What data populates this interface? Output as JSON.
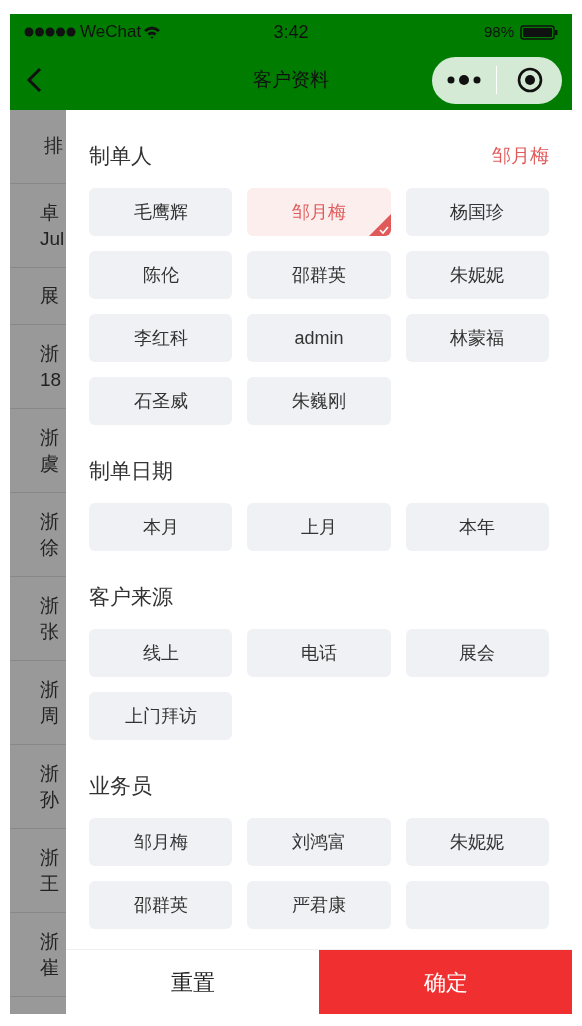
{
  "status_bar": {
    "carrier": "WeChat",
    "time": "3:42",
    "battery": "98%"
  },
  "nav": {
    "title": "客户资料"
  },
  "background_list": {
    "header": "排",
    "rows": [
      {
        "lines": [
          "卓",
          "Jul"
        ]
      },
      {
        "lines": [
          "展"
        ]
      },
      {
        "lines": [
          "浙",
          "18"
        ]
      },
      {
        "lines": [
          "浙",
          "虞"
        ]
      },
      {
        "lines": [
          "浙",
          "徐"
        ]
      },
      {
        "lines": [
          "浙",
          "张"
        ]
      },
      {
        "lines": [
          "浙",
          "周"
        ]
      },
      {
        "lines": [
          "浙",
          "孙"
        ]
      },
      {
        "lines": [
          "浙",
          "王"
        ]
      },
      {
        "lines": [
          "浙",
          "崔"
        ]
      }
    ]
  },
  "filter_sections": [
    {
      "title": "制单人",
      "value": "邹月梅",
      "options": [
        {
          "label": "毛鹰辉",
          "selected": false
        },
        {
          "label": "邹月梅",
          "selected": true
        },
        {
          "label": "杨国珍",
          "selected": false
        },
        {
          "label": "陈伦",
          "selected": false
        },
        {
          "label": "邵群英",
          "selected": false
        },
        {
          "label": "朱妮妮",
          "selected": false
        },
        {
          "label": "李红科",
          "selected": false
        },
        {
          "label": "admin",
          "selected": false
        },
        {
          "label": "林蒙福",
          "selected": false
        },
        {
          "label": "石圣威",
          "selected": false
        },
        {
          "label": "朱巍刚",
          "selected": false
        }
      ]
    },
    {
      "title": "制单日期",
      "options": [
        {
          "label": "本月",
          "selected": false
        },
        {
          "label": "上月",
          "selected": false
        },
        {
          "label": "本年",
          "selected": false
        }
      ]
    },
    {
      "title": "客户来源",
      "options": [
        {
          "label": "线上",
          "selected": false
        },
        {
          "label": "电话",
          "selected": false
        },
        {
          "label": "展会",
          "selected": false
        },
        {
          "label": "上门拜访",
          "selected": false
        }
      ]
    },
    {
      "title": "业务员",
      "options": [
        {
          "label": "邹月梅",
          "selected": false
        },
        {
          "label": "刘鸿富",
          "selected": false
        },
        {
          "label": "朱妮妮",
          "selected": false
        },
        {
          "label": "邵群英",
          "selected": false
        },
        {
          "label": "严君康",
          "selected": false
        },
        {
          "selected": false
        }
      ]
    }
  ],
  "buttons": {
    "reset": "重置",
    "confirm": "确定"
  }
}
